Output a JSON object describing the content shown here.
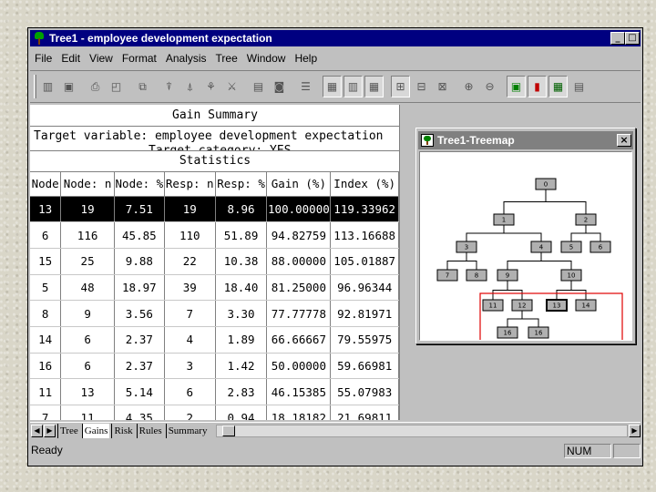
{
  "window": {
    "title": "Tree1 - employee development expectation",
    "min_btn": "_",
    "max_btn": "□"
  },
  "menu": [
    "File",
    "Edit",
    "View",
    "Format",
    "Analysis",
    "Tree",
    "Window",
    "Help"
  ],
  "gains": {
    "summary_title": "Gain Summary",
    "target_variable": "Target variable: employee development expectation",
    "target_category": "Target category: YES",
    "statistics_title": "Statistics",
    "columns": [
      "Node",
      "Node: n",
      "Node: %",
      "Resp: n",
      "Resp: %",
      "Gain (%)",
      "Index (%)"
    ],
    "rows": [
      [
        "13",
        "19",
        "7.51",
        "19",
        "8.96",
        "100.00000",
        "119.33962"
      ],
      [
        "6",
        "116",
        "45.85",
        "110",
        "51.89",
        "94.82759",
        "113.16688"
      ],
      [
        "15",
        "25",
        "9.88",
        "22",
        "10.38",
        "88.00000",
        "105.01887"
      ],
      [
        "5",
        "48",
        "18.97",
        "39",
        "18.40",
        "81.25000",
        "96.96344"
      ],
      [
        "8",
        "9",
        "3.56",
        "7",
        "3.30",
        "77.77778",
        "92.81971"
      ],
      [
        "14",
        "6",
        "2.37",
        "4",
        "1.89",
        "66.66667",
        "79.55975"
      ],
      [
        "16",
        "6",
        "2.37",
        "3",
        "1.42",
        "50.00000",
        "59.66981"
      ],
      [
        "11",
        "13",
        "5.14",
        "6",
        "2.83",
        "46.15385",
        "55.07983"
      ],
      [
        "7",
        "11",
        "4.35",
        "2",
        "0.94",
        "18.18182",
        "21.69811"
      ]
    ],
    "selected_row": 0
  },
  "tabs": [
    "Tree",
    "Gains",
    "Risk",
    "Rules",
    "Summary"
  ],
  "active_tab": "Gains",
  "status": {
    "text": "Ready",
    "num": "NUM"
  },
  "treemap": {
    "title": "Tree1-Treemap",
    "close": "×",
    "node_labels": [
      "0",
      "1",
      "2",
      "3",
      "4",
      "5",
      "6",
      "7",
      "8",
      "9",
      "10",
      "11",
      "12",
      "13",
      "14",
      "16",
      "16"
    ],
    "highlight_color": "#e00000",
    "node_fill": "#b0b0b0"
  }
}
